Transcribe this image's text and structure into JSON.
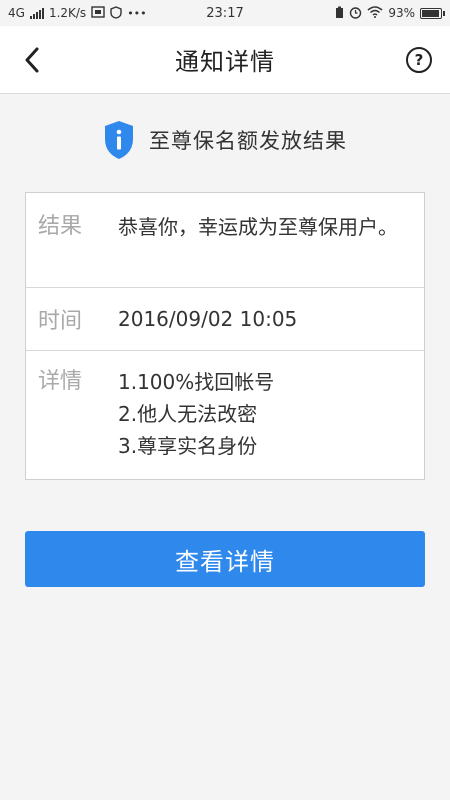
{
  "status_bar": {
    "network": "4G",
    "speed": "1.2K/s",
    "time": "23:17",
    "battery": "93%",
    "battery_level": 0.93
  },
  "nav": {
    "title": "通知详情",
    "back_icon": "chevron-left-icon",
    "help_icon": "question-circle-icon",
    "help_glyph": "?"
  },
  "headline": {
    "icon": "info-shield-icon",
    "text": "至尊保名额发放结果",
    "accent_color": "#2f89ec"
  },
  "info": {
    "result": {
      "label": "结果",
      "value": "恭喜你，幸运成为至尊保用户。"
    },
    "time": {
      "label": "时间",
      "value": "2016/09/02 10:05"
    },
    "detail": {
      "label": "详情",
      "lines": [
        "1.100%找回帐号",
        "2.他人无法改密",
        "3.尊享实名身份"
      ]
    }
  },
  "action": {
    "label": "查看详情",
    "color": "#2f89ec"
  }
}
